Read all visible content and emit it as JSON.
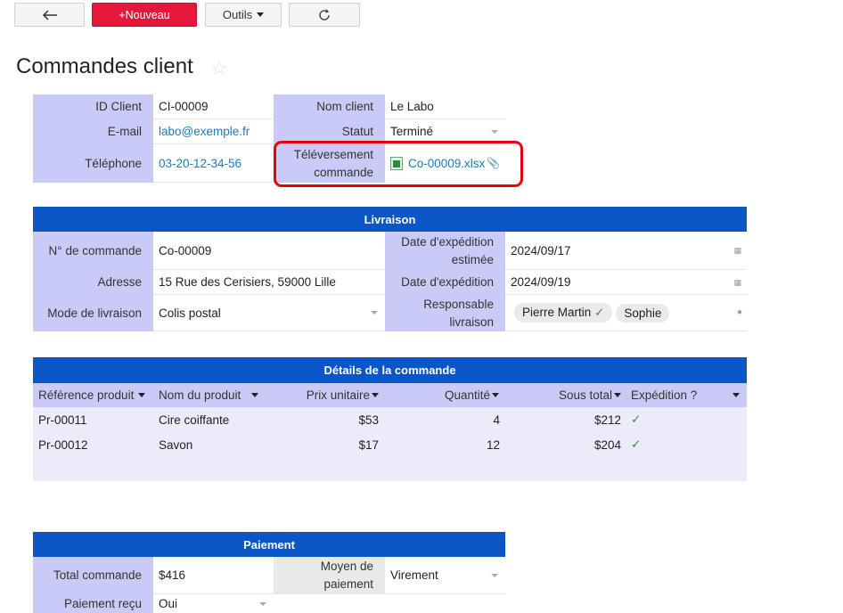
{
  "toolbar": {
    "back_icon": "arrow-left-icon",
    "new_label": "+Nouveau",
    "tools_label": "Outils",
    "refresh_icon": "refresh-icon"
  },
  "page": {
    "title": "Commandes client"
  },
  "client": {
    "id_label": "ID Client",
    "id_value": "CI-00009",
    "email_label": "E-mail",
    "email_value": "labo@exemple.fr",
    "phone_label": "Téléphone",
    "phone_value": "03-20-12-34-56",
    "name_label": "Nom client",
    "name_value": "Le Labo",
    "status_label": "Statut",
    "status_value": "Terminé",
    "upload_label": "Téléversement commande",
    "upload_value": "Co-00009.xlsx"
  },
  "livraison": {
    "title": "Livraison",
    "order_label": "N° de commande",
    "order_value": "Co-00009",
    "address_label": "Adresse",
    "address_value": "15 Rue des Cerisiers, 59000 Lille",
    "mode_label": "Mode de livraison",
    "mode_value": "Colis postal",
    "est_date_label": "Date d'expédition estimée",
    "est_date_value": "2024/09/17",
    "ship_date_label": "Date d'expédition",
    "ship_date_value": "2024/09/19",
    "resp_label": "Responsable livraison",
    "resp": [
      "Pierre Martin",
      "Sophie"
    ]
  },
  "details": {
    "title": "Détails de la commande",
    "columns": [
      "Référence produit",
      "Nom du produit",
      "Prix unitaire",
      "Quantité",
      "Sous total",
      "Expédition ?"
    ],
    "rows": [
      {
        "ref": "Pr-00011",
        "name": "Cire coiffante",
        "price": "$53",
        "qty": "4",
        "subtotal": "$212",
        "shipped": "✓"
      },
      {
        "ref": "Pr-00012",
        "name": "Savon",
        "price": "$17",
        "qty": "12",
        "subtotal": "$204",
        "shipped": "✓"
      }
    ]
  },
  "paiement": {
    "title": "Paiement",
    "total_label": "Total commande",
    "total_value": "$416",
    "method_label": "Moyen de paiement",
    "method_value": "Virement",
    "received_label": "Paiement reçu",
    "received_value": "Oui"
  },
  "colors": {
    "accent": "#e5173a",
    "header_blue": "#0b56c6",
    "label_bg": "#c9cbf6",
    "link": "#1a7bc0"
  }
}
